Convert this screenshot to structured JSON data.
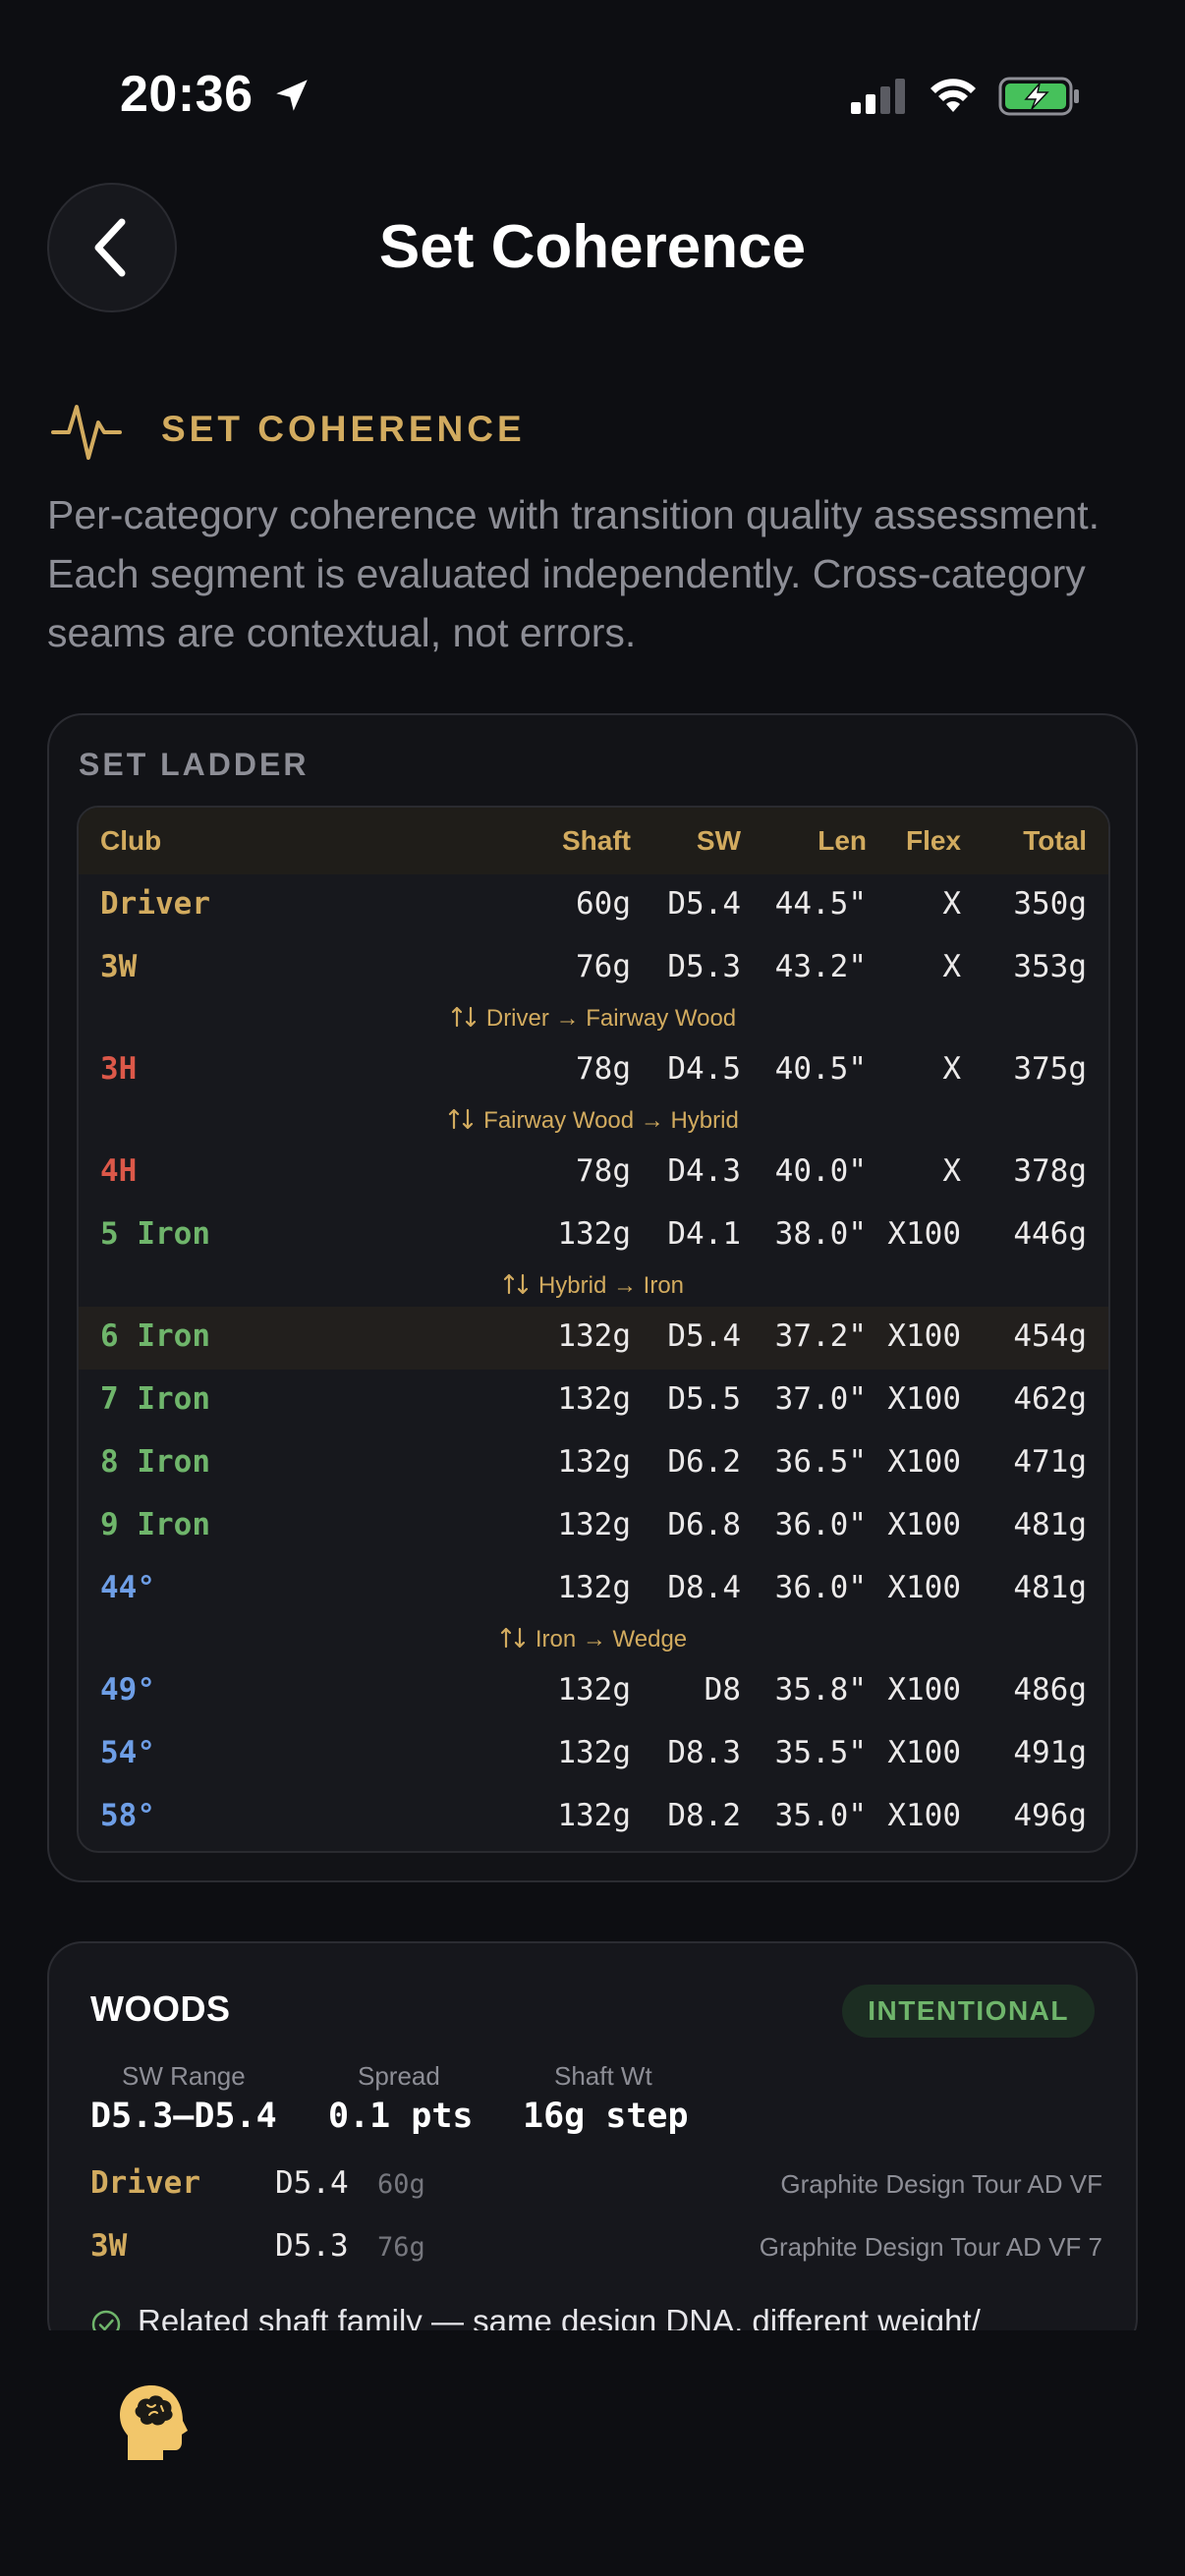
{
  "status_bar": {
    "time": "20:36"
  },
  "nav": {
    "title": "Set Coherence"
  },
  "section": {
    "label": "SET COHERENCE",
    "description": "Per-category coherence with transition quality assessment. Each segment is evaluated independently. Cross-category seams are contextual, not errors."
  },
  "ladder": {
    "title": "SET LADDER",
    "headers": {
      "club": "Club",
      "shaft": "Shaft",
      "sw": "SW",
      "len": "Len",
      "flex": "Flex",
      "total": "Total"
    },
    "rows": [
      {
        "club": "Driver",
        "shaft": "60g",
        "sw": "D5.4",
        "len": "44.5\"",
        "flex": "X",
        "total": "350g",
        "color": "#d2ab5f"
      },
      {
        "club": "3W",
        "shaft": "76g",
        "sw": "D5.3",
        "len": "43.2\"",
        "flex": "X",
        "total": "353g",
        "color": "#d2ab5f"
      },
      {
        "club": "3H",
        "shaft": "78g",
        "sw": "D4.5",
        "len": "40.5\"",
        "flex": "X",
        "total": "375g",
        "color": "#dc5849"
      },
      {
        "club": "4H",
        "shaft": "78g",
        "sw": "D4.3",
        "len": "40.0\"",
        "flex": "X",
        "total": "378g",
        "color": "#dc5849"
      },
      {
        "club": "5 Iron",
        "shaft": "132g",
        "sw": "D4.1",
        "len": "38.0\"",
        "flex": "X100",
        "total": "446g",
        "color": "#6fb56b"
      },
      {
        "club": "6 Iron",
        "shaft": "132g",
        "sw": "D5.4",
        "len": "37.2\"",
        "flex": "X100",
        "total": "454g",
        "color": "#6fb56b"
      },
      {
        "club": "7 Iron",
        "shaft": "132g",
        "sw": "D5.5",
        "len": "37.0\"",
        "flex": "X100",
        "total": "462g",
        "color": "#6fb56b"
      },
      {
        "club": "8 Iron",
        "shaft": "132g",
        "sw": "D6.2",
        "len": "36.5\"",
        "flex": "X100",
        "total": "471g",
        "color": "#6fb56b"
      },
      {
        "club": "9 Iron",
        "shaft": "132g",
        "sw": "D6.8",
        "len": "36.0\"",
        "flex": "X100",
        "total": "481g",
        "color": "#6fb56b"
      },
      {
        "club": "44°",
        "shaft": "132g",
        "sw": "D8.4",
        "len": "36.0\"",
        "flex": "X100",
        "total": "481g",
        "color": "#6e9ee6"
      },
      {
        "club": "49°",
        "shaft": "132g",
        "sw": "D8",
        "len": "35.8\"",
        "flex": "X100",
        "total": "486g",
        "color": "#6e9ee6"
      },
      {
        "club": "54°",
        "shaft": "132g",
        "sw": "D8.3",
        "len": "35.5\"",
        "flex": "X100",
        "total": "491g",
        "color": "#6e9ee6"
      },
      {
        "club": "58°",
        "shaft": "132g",
        "sw": "D8.2",
        "len": "35.0\"",
        "flex": "X100",
        "total": "496g",
        "color": "#6e9ee6"
      }
    ],
    "transitions": [
      "Driver → Fairway Wood",
      "Fairway Wood → Hybrid",
      "Hybrid → Iron",
      "Iron → Wedge"
    ]
  },
  "woods": {
    "title": "WOODS",
    "badge": "INTENTIONAL",
    "stats": [
      {
        "label": "SW Range",
        "value": "D5.3–D5.4"
      },
      {
        "label": "Spread",
        "value": "0.1 pts"
      },
      {
        "label": "Shaft Wt",
        "value": "16g step"
      }
    ],
    "clubs": [
      {
        "name": "Driver",
        "sw": "D5.4",
        "weight": "60g",
        "model": "Graphite Design Tour AD VF"
      },
      {
        "name": "3W",
        "sw": "D5.3",
        "weight": "76g",
        "model": "Graphite Design Tour AD VF 7"
      }
    ],
    "note": "Related shaft family — same design DNA, different weight/"
  },
  "icons": {
    "back": "chevron-left-icon",
    "pulse": "pulse-icon",
    "transition": "transition-arrows-icon",
    "check": "check-circle-icon",
    "brain": "brain-head-icon"
  },
  "colors": {
    "accent_gold": "#d2ab5f",
    "wood": "#d2ab5f",
    "hybrid": "#dc5849",
    "iron": "#6fb56b",
    "wedge": "#6e9ee6",
    "badge_green": "#6fb56b"
  }
}
